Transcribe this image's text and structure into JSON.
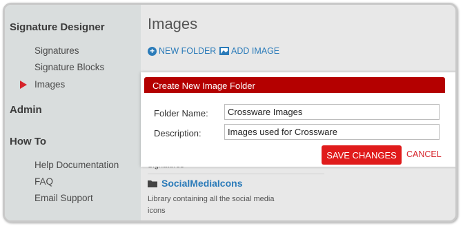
{
  "sidebar": {
    "sections": [
      {
        "title": "Signature Designer",
        "items": [
          "Signatures",
          "Signature Blocks",
          "Images"
        ]
      },
      {
        "title": "Admin",
        "items": []
      },
      {
        "title": "How To",
        "items": [
          "Help Documentation",
          "FAQ",
          "Email Support"
        ]
      }
    ],
    "active_item": "Images"
  },
  "main": {
    "title": "Images",
    "actions": {
      "new_folder": "NEW FOLDER",
      "add_image": "ADD IMAGE"
    },
    "partial_text": "Signatures",
    "folders": [
      {
        "name": "SocialMediaIcons",
        "description": "Library containing all the social media icons"
      }
    ]
  },
  "dialog": {
    "title": "Create New Image Folder",
    "fields": {
      "folder_name": {
        "label": "Folder Name:",
        "value": "Crossware Images"
      },
      "description": {
        "label": "Description:",
        "value": "Images used for Crossware"
      }
    },
    "save_label": "SAVE CHANGES",
    "cancel_label": "CANCEL"
  },
  "colors": {
    "accent_blue": "#2b7bb9",
    "header_red": "#b40000",
    "button_red": "#e01b1b",
    "arrow_red": "#d6242b"
  }
}
